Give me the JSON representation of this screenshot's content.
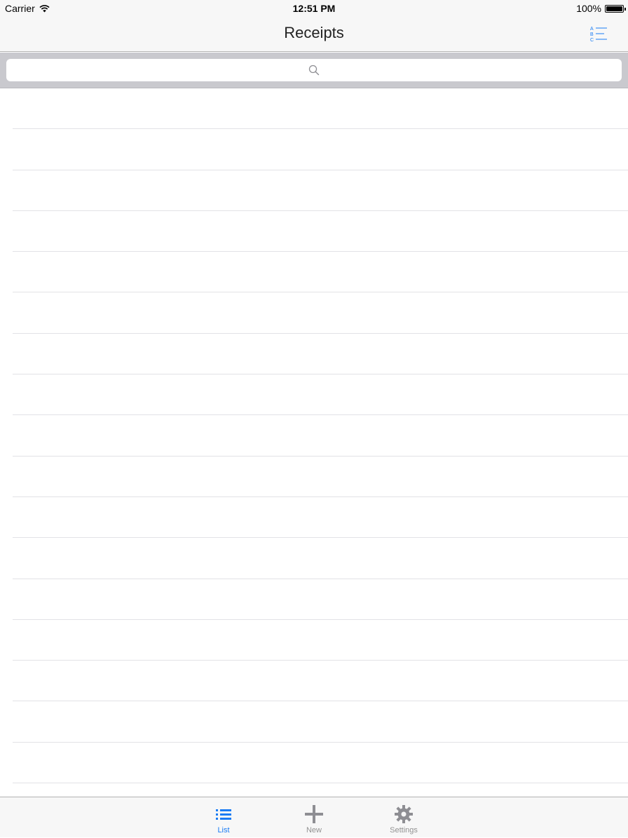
{
  "status_bar": {
    "carrier": "Carrier",
    "time": "12:51 PM",
    "battery": "100%"
  },
  "nav": {
    "title": "Receipts",
    "sort_icon": "abc-sort-icon"
  },
  "search": {
    "placeholder": "",
    "value": "",
    "icon": "search-icon"
  },
  "table": {
    "rows": [
      "",
      "",
      "",
      "",
      "",
      "",
      "",
      "",
      "",
      "",
      "",
      "",
      "",
      "",
      "",
      "",
      ""
    ]
  },
  "tab_bar": {
    "tabs": [
      {
        "label": "List",
        "icon": "list-icon",
        "active": true
      },
      {
        "label": "New",
        "icon": "plus-icon",
        "active": false
      },
      {
        "label": "Settings",
        "icon": "gear-icon",
        "active": false
      }
    ]
  },
  "colors": {
    "accent": "#1a7cf4",
    "inactive": "#929292",
    "bar_background": "#f7f7f7",
    "search_background": "#c9c9ce"
  }
}
